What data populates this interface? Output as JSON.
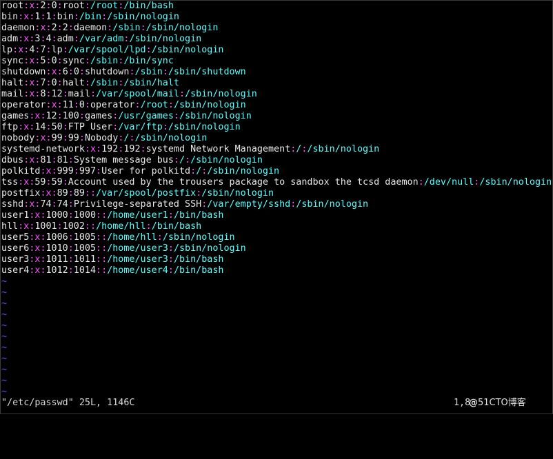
{
  "colors": {
    "field": "#e8e8e8",
    "separator": "#ff55ff",
    "path": "#55ffff",
    "tilde": "#5555ff"
  },
  "buffer": {
    "lines": [
      "root:x:2:0:root:/root:/bin/bash",
      "bin:x:1:1:bin:/bin:/sbin/nologin",
      "daemon:x:2:2:daemon:/sbin:/sbin/nologin",
      "adm:x:3:4:adm:/var/adm:/sbin/nologin",
      "lp:x:4:7:lp:/var/spool/lpd:/sbin/nologin",
      "sync:x:5:0:sync:/sbin:/bin/sync",
      "shutdown:x:6:0:shutdown:/sbin:/sbin/shutdown",
      "halt:x:7:0:halt:/sbin:/sbin/halt",
      "mail:x:8:12:mail:/var/spool/mail:/sbin/nologin",
      "operator:x:11:0:operator:/root:/sbin/nologin",
      "games:x:12:100:games:/usr/games:/sbin/nologin",
      "ftp:x:14:50:FTP User:/var/ftp:/sbin/nologin",
      "nobody:x:99:99:Nobody:/:/sbin/nologin",
      "systemd-network:x:192:192:systemd Network Management:/:/sbin/nologin",
      "dbus:x:81:81:System message bus:/:/sbin/nologin",
      "polkitd:x:999:997:User for polkitd:/:/sbin/nologin",
      "tss:x:59:59:Account used by the trousers package to sandbox the tcsd daemon:/dev/null:/sbin/nologin",
      "postfix:x:89:89::/var/spool/postfix:/sbin/nologin",
      "sshd:x:74:74:Privilege-separated SSH:/var/empty/sshd:/sbin/nologin",
      "user1:x:1000:1000::/home/user1:/bin/bash",
      "hll:x:1001:1002::/home/hll:/bin/bash",
      "user5:x:1006:1005::/home/hll:/sbin/nologin",
      "user6:x:1010:1005::/home/user3:/sbin/nologin",
      "user3:x:1011:1011::/home/user3:/bin/bash",
      "user4:x:1012:1014::/home/user4:/bin/bash"
    ],
    "empty_line_marker": "~",
    "empty_line_count": 11
  },
  "statusbar": {
    "file_info": "\"/etc/passwd\" 25L, 1146C",
    "cursor_position": "1,8"
  },
  "watermark": {
    "mark": "@",
    "text": "51CTO博客"
  }
}
